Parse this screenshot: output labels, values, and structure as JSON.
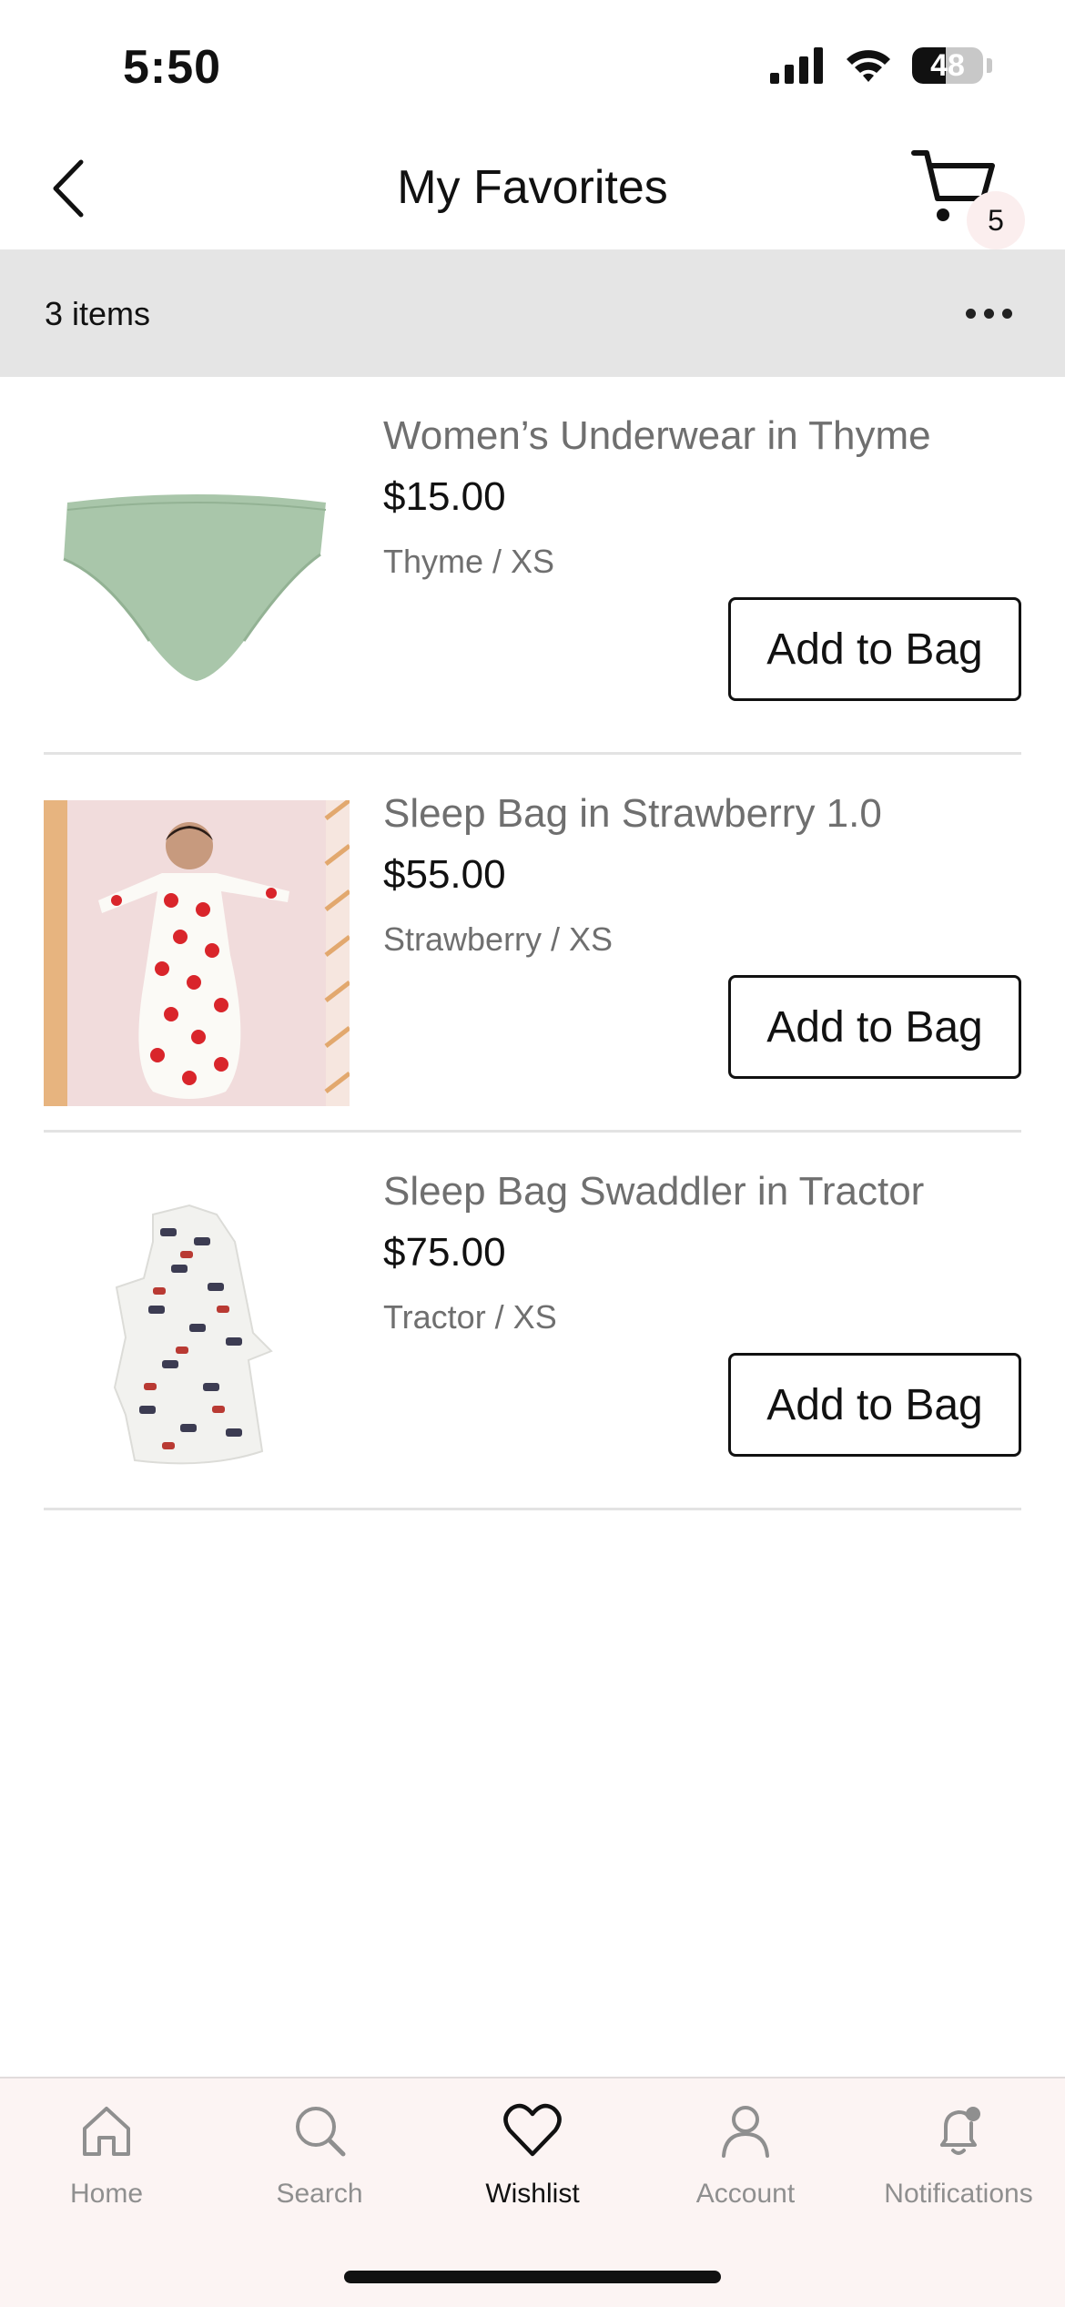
{
  "status_bar": {
    "time": "5:50",
    "battery": "48",
    "battery_level": 0.48
  },
  "header": {
    "title": "My Favorites",
    "cart_count": "5"
  },
  "summary": {
    "count_text": "3 items"
  },
  "products": [
    {
      "name": "Women’s Underwear in Thyme",
      "price": "$15.00",
      "variant": "Thyme / XS",
      "button": "Add to Bag"
    },
    {
      "name": "Sleep Bag in Strawberry 1.0",
      "price": "$55.00",
      "variant": "Strawberry / XS",
      "button": "Add to Bag"
    },
    {
      "name": "Sleep Bag Swaddler in Tractor",
      "price": "$75.00",
      "variant": "Tractor / XS",
      "button": "Add to Bag"
    }
  ],
  "tabs": [
    {
      "label": "Home",
      "icon": "home-icon"
    },
    {
      "label": "Search",
      "icon": "search-icon"
    },
    {
      "label": "Wishlist",
      "icon": "heart-icon",
      "active": true
    },
    {
      "label": "Account",
      "icon": "person-icon"
    },
    {
      "label": "Notifications",
      "icon": "bell-icon"
    }
  ],
  "colors": {
    "accent_bg": "#fcf4f3",
    "count_bar": "#e5e5e5",
    "product_green": "#a9c6aa"
  }
}
